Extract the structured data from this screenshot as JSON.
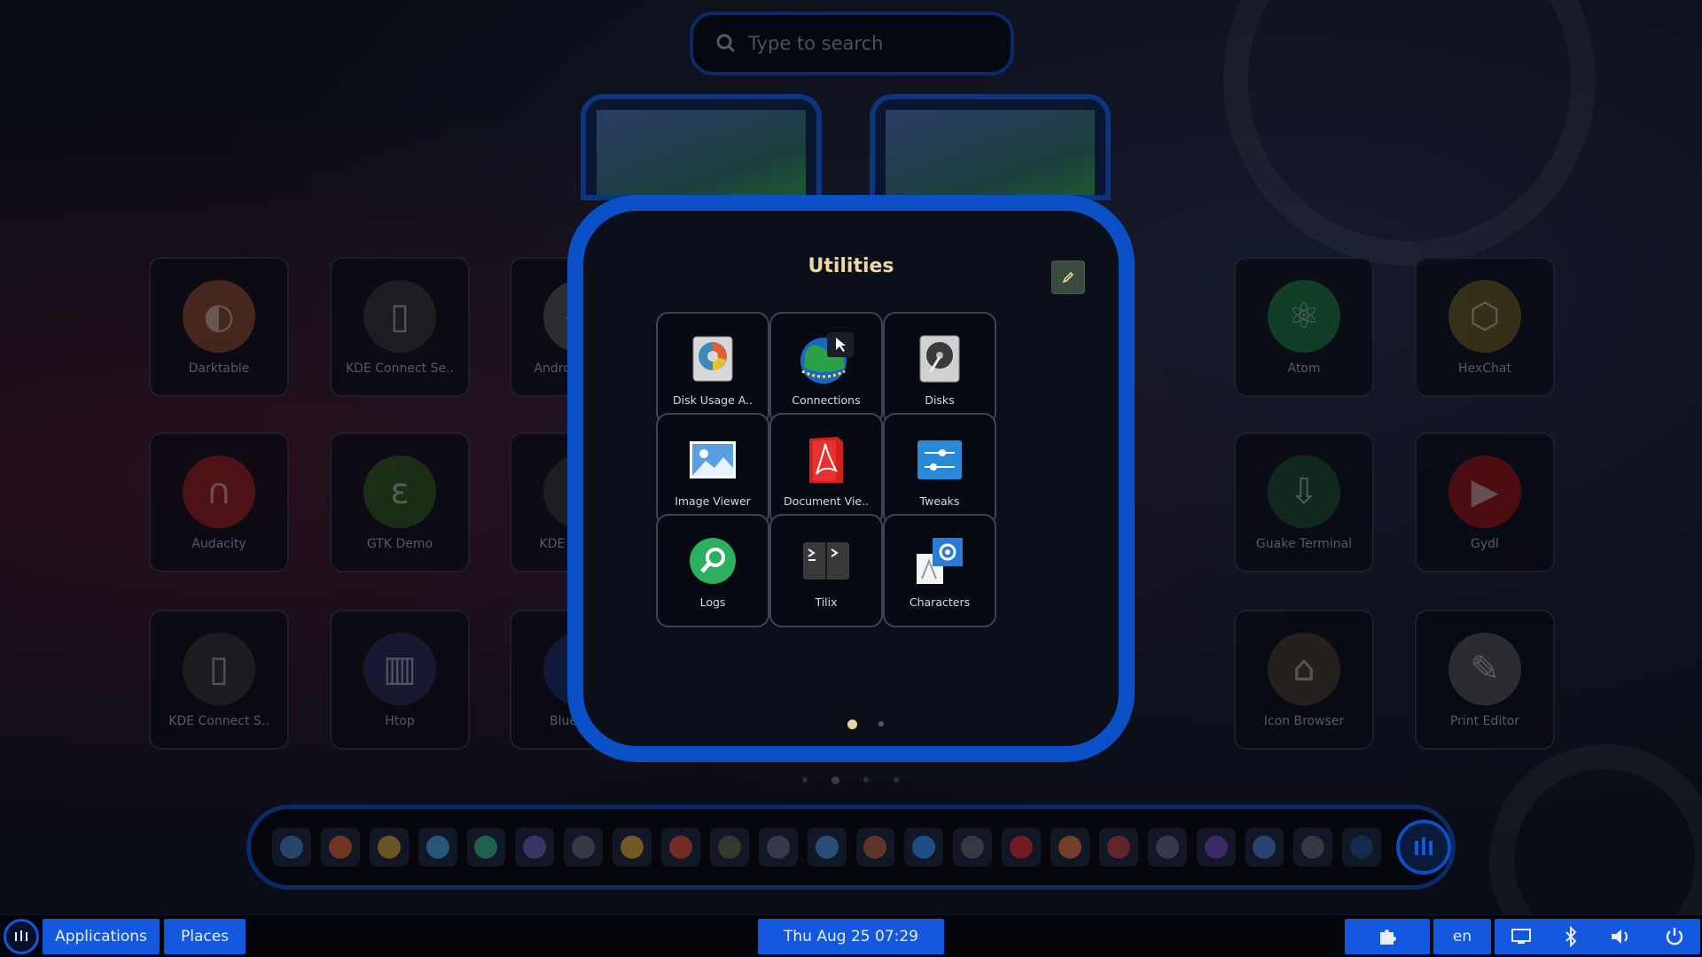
{
  "search": {
    "placeholder": "Type to search"
  },
  "background_apps": [
    {
      "label": "Darktable",
      "color": "#8a4a2a",
      "glyph": "◐"
    },
    {
      "label": "KDE Connect Se..",
      "color": "#333",
      "glyph": "▯"
    },
    {
      "label": "Android Studio",
      "color": "#555",
      "glyph": "◆"
    },
    {
      "label": "Atom",
      "color": "#1a7a3a",
      "glyph": "⚛"
    },
    {
      "label": "HexChat",
      "color": "#6a5a1a",
      "glyph": "⬡"
    },
    {
      "label": "Audacity",
      "color": "#9a1a1a",
      "glyph": "∩"
    },
    {
      "label": "GTK Demo",
      "color": "#2a5a1a",
      "glyph": "ɛ"
    },
    {
      "label": "KDE Connect",
      "color": "#333",
      "glyph": "▯"
    },
    {
      "label": "Guake Terminal",
      "color": "#1a4a2a",
      "glyph": "⇩"
    },
    {
      "label": "Gydl",
      "color": "#9a1010",
      "glyph": "▶"
    },
    {
      "label": "KDE Connect S..",
      "color": "#333",
      "glyph": "▯"
    },
    {
      "label": "Htop",
      "color": "#2a2a5a",
      "glyph": "▥"
    },
    {
      "label": "Bluetooth",
      "color": "#1a2a6a",
      "glyph": "✱"
    },
    {
      "label": "Icon Browser",
      "color": "#4a3a2a",
      "glyph": "⌂"
    },
    {
      "label": "Print Editor",
      "color": "#555",
      "glyph": "✎"
    }
  ],
  "folder": {
    "title": "Utilities",
    "apps": [
      {
        "label": "Disk Usage A..",
        "icon": "disk-usage-icon"
      },
      {
        "label": "Connections",
        "icon": "connections-icon"
      },
      {
        "label": "Disks",
        "icon": "disks-icon"
      },
      {
        "label": "Image Viewer",
        "icon": "image-viewer-icon"
      },
      {
        "label": "Document Vie..",
        "icon": "document-viewer-icon"
      },
      {
        "label": "Tweaks",
        "icon": "tweaks-icon"
      },
      {
        "label": "Logs",
        "icon": "logs-icon"
      },
      {
        "label": "Tilix",
        "icon": "tilix-icon"
      },
      {
        "label": "Characters",
        "icon": "characters-icon"
      }
    ]
  },
  "dock_icon_colors": [
    "#3a6aa0",
    "#c05020",
    "#b08a20",
    "#3a8ac0",
    "#2a9a6a",
    "#5a4a9a",
    "#555",
    "#c09020",
    "#c04020",
    "#553",
    "#556",
    "#3a7ac0",
    "#a05030",
    "#2a7ad0",
    "#555",
    "#c02020",
    "#c06030",
    "#a03030",
    "#556",
    "#5a3a9a",
    "#3a6ab0",
    "#555",
    "#1a3a6a"
  ],
  "panel": {
    "applications": "Applications",
    "places": "Places",
    "clock": "Thu Aug 25  07:29",
    "lang": "en"
  },
  "colors": {
    "accent": "#0b50c6",
    "panel_button": "#1558e0",
    "folder_title": "#f0d8a0"
  }
}
